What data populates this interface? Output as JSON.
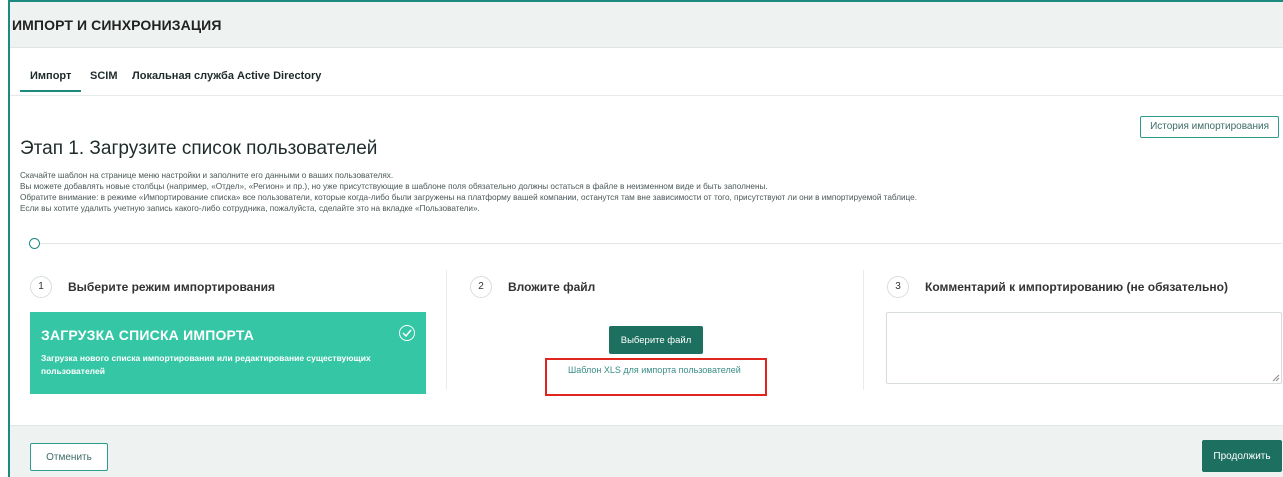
{
  "header": {
    "title": "ИМПОРТ И СИНХРОНИЗАЦИЯ"
  },
  "tabs": [
    {
      "label": "Импорт",
      "active": true
    },
    {
      "label": "SCIM",
      "active": false
    },
    {
      "label": "Локальная служба Active Directory",
      "active": false
    }
  ],
  "history_button": "История импортирования",
  "stage_title": "Этап 1. Загрузите список пользователей",
  "description": [
    "Скачайте шаблон на странице меню настройки и заполните его данными о ваших пользователях.",
    "Вы можете добавлять новые столбцы (например, «Отдел», «Регион» и пр.), но уже присутствующие в шаблоне поля обязательно должны остаться в файле в неизменном виде и быть заполнены.",
    "Обратите внимание: в режиме «Импортирование списка» все пользователи, которые когда-либо были загружены на платформу вашей компании, останутся там вне зависимости от того, присутствуют ли они в импортируемой таблице.",
    "Если вы хотите удалить учетную запись какого-либо сотрудника, пожалуйста, сделайте это на вкладке «Пользователи»."
  ],
  "steps": [
    {
      "number": "1",
      "title": "Выберите режим импортирования"
    },
    {
      "number": "2",
      "title": "Вложите файл"
    },
    {
      "number": "3",
      "title": "Комментарий к импортированию (не обязательно)"
    }
  ],
  "import_mode": {
    "title": "ЗАГРУЗКА СПИСКА ИМПОРТА",
    "description": "Загрузка нового списка импортирования или редактирование существующих пользователей",
    "selected": true
  },
  "file": {
    "choose_button": "Выберите файл",
    "template_link": "Шаблон XLS для импорта пользователей"
  },
  "comment": {
    "value": ""
  },
  "footer": {
    "cancel": "Отменить",
    "continue": "Продолжить"
  },
  "colors": {
    "accent": "#1d8a80",
    "card": "#35c7a5",
    "button_dark": "#1d6f60",
    "highlight_box": "#e0251f"
  }
}
